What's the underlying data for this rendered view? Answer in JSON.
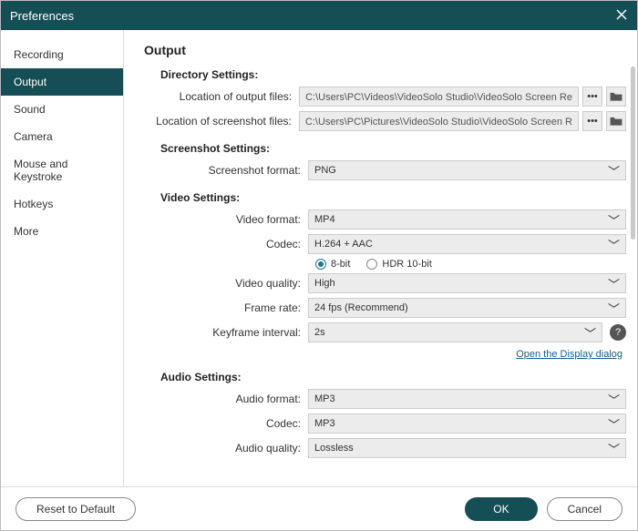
{
  "window": {
    "title": "Preferences"
  },
  "sidebar": {
    "items": [
      {
        "label": "Recording"
      },
      {
        "label": "Output",
        "active": true
      },
      {
        "label": "Sound"
      },
      {
        "label": "Camera"
      },
      {
        "label": "Mouse and Keystroke"
      },
      {
        "label": "Hotkeys"
      },
      {
        "label": "More"
      }
    ]
  },
  "main": {
    "title": "Output",
    "sections": {
      "directory": {
        "heading": "Directory Settings:",
        "output_label": "Location of output files:",
        "output_value": "C:\\Users\\PC\\Videos\\VideoSolo Studio\\VideoSolo Screen Re",
        "screenshot_label": "Location of screenshot files:",
        "screenshot_value": "C:\\Users\\PC\\Pictures\\VideoSolo Studio\\VideoSolo Screen R"
      },
      "screenshot": {
        "heading": "Screenshot Settings:",
        "format_label": "Screenshot format:",
        "format_value": "PNG"
      },
      "video": {
        "heading": "Video Settings:",
        "format_label": "Video format:",
        "format_value": "MP4",
        "codec_label": "Codec:",
        "codec_value": "H.264 + AAC",
        "bit_8": "8-bit",
        "bit_hdr": "HDR 10-bit",
        "quality_label": "Video quality:",
        "quality_value": "High",
        "framerate_label": "Frame rate:",
        "framerate_value": "24 fps (Recommend)",
        "keyframe_label": "Keyframe interval:",
        "keyframe_value": "2s",
        "display_link": "Open the Display dialog"
      },
      "audio": {
        "heading": "Audio Settings:",
        "format_label": "Audio format:",
        "format_value": "MP3",
        "codec_label": "Codec:",
        "codec_value": "MP3",
        "quality_label": "Audio quality:",
        "quality_value": "Lossless"
      }
    }
  },
  "footer": {
    "reset": "Reset to Default",
    "ok": "OK",
    "cancel": "Cancel"
  },
  "icons": {
    "browse": "•••",
    "chevron": "﹀",
    "help": "?"
  }
}
